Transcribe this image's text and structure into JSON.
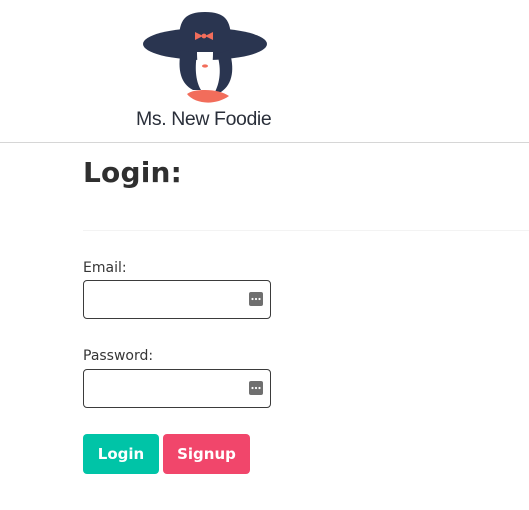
{
  "brand": {
    "logo_text": "Ms. New Foodie",
    "colors": {
      "navy": "#2a3550",
      "coral": "#f26d5b"
    }
  },
  "page": {
    "title": "Login:"
  },
  "form": {
    "email_label": "Email:",
    "email_value": "",
    "password_label": "Password:",
    "password_value": ""
  },
  "buttons": {
    "login_label": "Login",
    "signup_label": "Signup",
    "login_color": "#00c4a7",
    "signup_color": "#f1466b"
  },
  "icons": {
    "field_autofill": "password-manager-icon"
  }
}
